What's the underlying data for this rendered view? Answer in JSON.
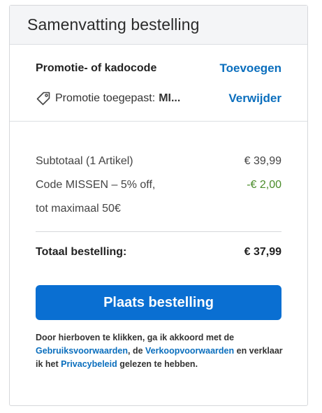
{
  "header": {
    "title": "Samenvatting bestelling"
  },
  "promo": {
    "label": "Promotie- of kadocode",
    "add_link": "Toevoegen",
    "applied_label": "Promotie toegepast:",
    "applied_code": "MI...",
    "remove_link": "Verwijder",
    "icon": "tag-icon"
  },
  "summary": {
    "subtotal_label": "Subtotaal (1 Artikel)",
    "subtotal_value": "€ 39,99",
    "discount_line1": "Code MISSEN – 5% off,",
    "discount_line2": "tot maximaal 50€",
    "discount_value": "-€ 2,00",
    "total_label": "Totaal bestelling:",
    "total_value": "€ 37,99"
  },
  "actions": {
    "place_order_label": "Plaats bestelling"
  },
  "legal": {
    "text_1": "Door hierboven te klikken, ga ik akkoord met de ",
    "link_terms": "Gebruiksvoorwaarden",
    "text_2": ", de ",
    "link_sales": "Verkoopvoorwaarden",
    "text_3": " en verklaar ik het ",
    "link_privacy": "Privacybeleid",
    "text_4": " gelezen te hebben."
  },
  "colors": {
    "accent": "#0a6fd2",
    "link": "#0a6ebd",
    "discount": "#4a8c2a"
  }
}
